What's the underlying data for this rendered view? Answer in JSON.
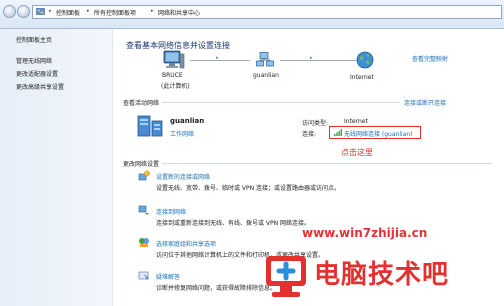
{
  "address_bar": {
    "crumbs": [
      "控制面板",
      "所有控制面板项",
      "网络和共享中心"
    ]
  },
  "sidebar": {
    "items": [
      {
        "label": "控制面板主页"
      },
      {
        "label": "管理无线网络"
      },
      {
        "label": "更改适配器设置"
      },
      {
        "label": "更改高级共享设置"
      }
    ]
  },
  "main": {
    "title": "查看基本网络信息并设置连接",
    "full_map_link": "查看完整映射",
    "map": {
      "computer_name": "BRUCE",
      "computer_sub": "(此计算机)",
      "network_name": "guanlian",
      "internet_label": "Internet"
    },
    "active_networks_heading": "查看活动网络",
    "connect_disconnect_link": "连接或断开连接",
    "active_network": {
      "name": "guanlian",
      "type": "工作网络",
      "access_type_label": "访问类型:",
      "access_type_value": "Internet",
      "connections_label": "连接:",
      "connection_link": "无线网络连接 (guanlian)"
    },
    "change_settings_heading": "更改网络设置",
    "tasks": [
      {
        "title": "设置新的连接或网络",
        "desc": "设置无线、宽带、拨号、临时或 VPN 连接；或设置路由器或访问点。"
      },
      {
        "title": "连接到网络",
        "desc": "连接到或重新连接到无线、有线、拨号或 VPN 网络连接。"
      },
      {
        "title": "选择家庭组和共享选项",
        "desc": "访问位于其他网络计算机上的文件和打印机，或更改共享设置。"
      },
      {
        "title": "疑难解答",
        "desc": "诊断并修复网络问题，或获得故障排除信息。"
      }
    ]
  },
  "annotation": {
    "click_here": "点击这里"
  },
  "watermark": {
    "url": "www.win7zhijia.cn",
    "brand": "电脑技术吧"
  }
}
